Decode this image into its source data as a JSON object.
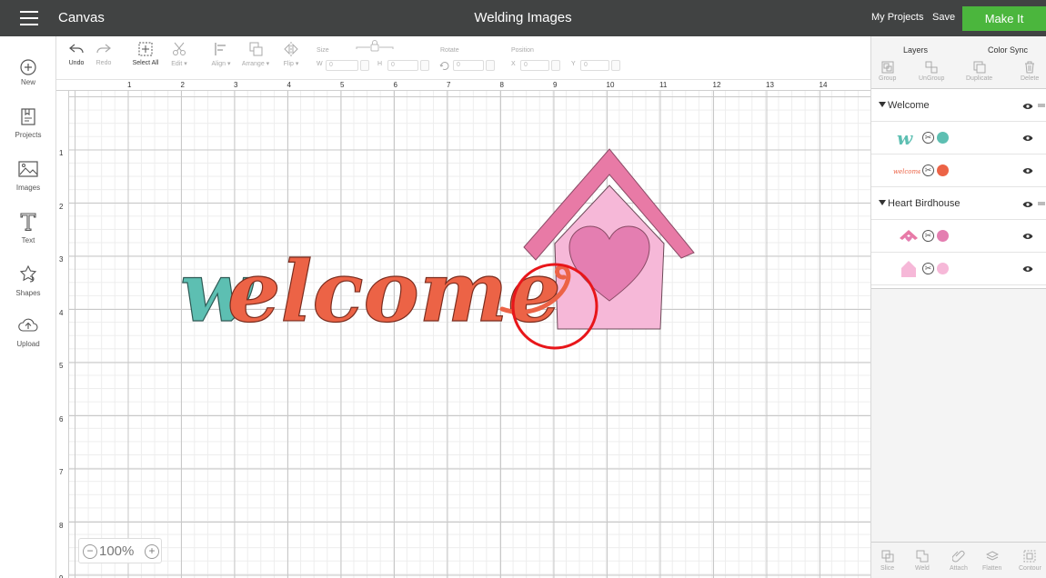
{
  "topbar": {
    "app_name": "Canvas",
    "doc_title": "Welding Images",
    "my_projects": "My Projects",
    "save": "Save",
    "make_it": "Make It",
    "make_it_color": "#4bb63d"
  },
  "sidebar": {
    "items": [
      {
        "label": "New",
        "icon": "plus-circle-icon"
      },
      {
        "label": "Projects",
        "icon": "projects-icon"
      },
      {
        "label": "Images",
        "icon": "image-icon"
      },
      {
        "label": "Text",
        "icon": "text-icon"
      },
      {
        "label": "Shapes",
        "icon": "shapes-icon"
      },
      {
        "label": "Upload",
        "icon": "upload-icon"
      }
    ]
  },
  "toolbar": {
    "undo": "Undo",
    "redo": "Redo",
    "select_all": "Select All",
    "edit": "Edit ▾",
    "align": "Align ▾",
    "arrange": "Arrange ▾",
    "flip": "Flip ▾",
    "size_label": "Size",
    "w_prefix": "W",
    "h_prefix": "H",
    "rotate_label": "Rotate",
    "position_label": "Position",
    "x_prefix": "X",
    "y_prefix": "Y",
    "field_value": "0"
  },
  "ruler": {
    "top": [
      "1",
      "2",
      "3",
      "4",
      "5",
      "6",
      "7",
      "8",
      "9",
      "10",
      "11",
      "12",
      "13",
      "14"
    ],
    "left": [
      "1",
      "2",
      "3",
      "4",
      "5",
      "6",
      "7",
      "8",
      "9"
    ]
  },
  "canvas": {
    "zoom_level": "100%",
    "zoom_out": "−",
    "zoom_in": "+",
    "welcome_text": "welcome"
  },
  "colors": {
    "welcome_teal": "#5dbfb2",
    "welcome_coral": "#ec6346",
    "roof_pink": "#e87aa6",
    "house_pink": "#f6b8d8",
    "heart_pink": "#e47eb1",
    "highlight_red": "#e8161a"
  },
  "layers_panel": {
    "tab_layers": "Layers",
    "tab_color_sync": "Color Sync",
    "actions": [
      "Group",
      "UnGroup",
      "Duplicate",
      "Delete"
    ],
    "groups": [
      {
        "name": "Welcome",
        "layers": [
          {
            "thumb": "w",
            "swatch": "#5dbfb2"
          },
          {
            "thumb": "welcome",
            "swatch": "#ec6346"
          }
        ]
      },
      {
        "name": "Heart Birdhouse",
        "layers": [
          {
            "thumb": "roof",
            "swatch": "#e47eb1"
          },
          {
            "thumb": "house",
            "swatch": "#f6b8d8"
          }
        ]
      }
    ],
    "bottom_actions": [
      "Slice",
      "Weld",
      "Attach",
      "Flatten",
      "Contour"
    ]
  }
}
